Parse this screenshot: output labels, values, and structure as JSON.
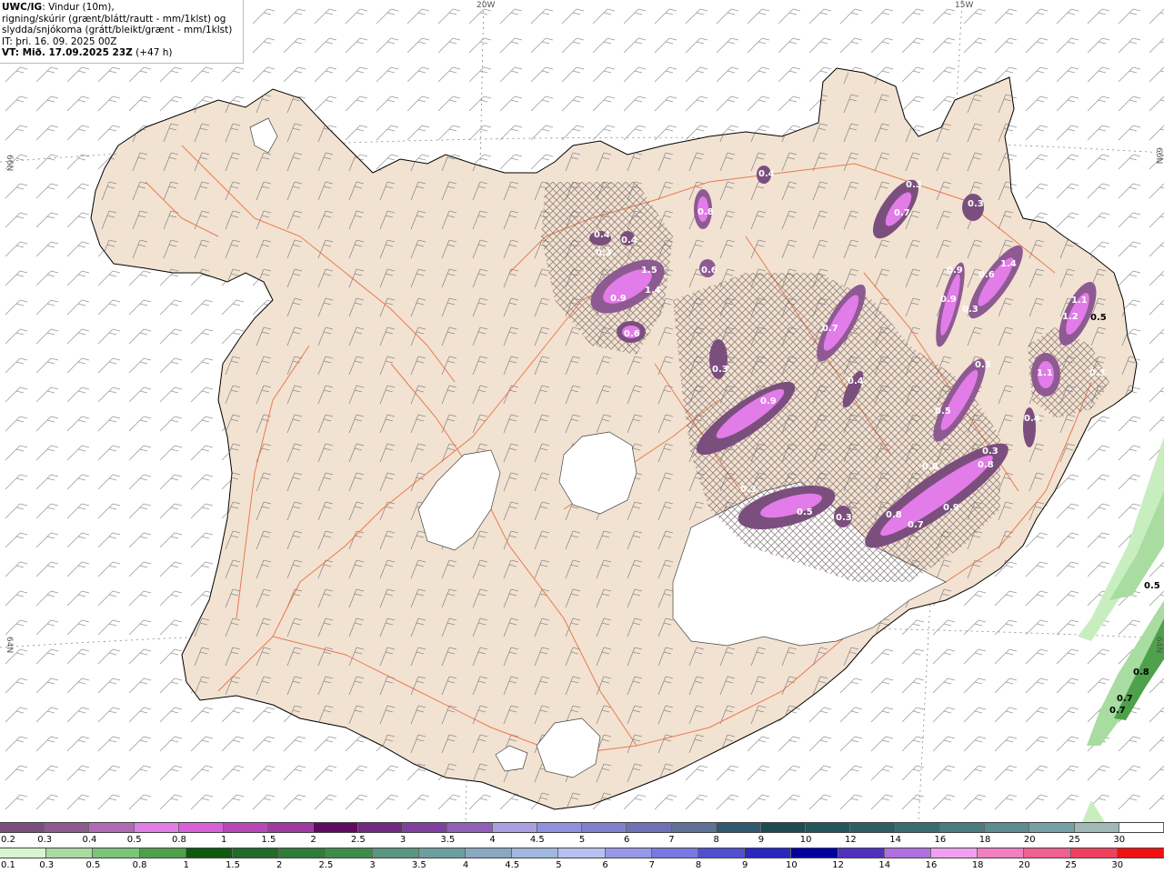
{
  "header": {
    "line1_bold": "UWC/IG",
    "line1_rest": ": Vindur (10m),",
    "line2": "rigning/skúrir (grænt/blátt/rautt - mm/1klst) og",
    "line3": "slydda/snjókoma (grátt/bleikt/grænt - mm/1klst)",
    "line4": "IT: þri. 16. 09. 2025 00Z",
    "line5_bold": "VT: Mið. 17.09.2025 23Z",
    "line5_rest": " (+47 h)"
  },
  "map": {
    "lon_labels": [
      "20W",
      "15W"
    ],
    "lat_labels": [
      "66N",
      "66N",
      "64N",
      "64N"
    ],
    "land_color": "#f2e2d2",
    "road_color": "#e8683a",
    "glacier_color": "#ffffff",
    "precip_values": [
      {
        "label": "0.4"
      },
      {
        "label": "0.4"
      },
      {
        "label": "0.3"
      },
      {
        "label": "1.5"
      },
      {
        "label": "0.9"
      },
      {
        "label": "1.4"
      },
      {
        "label": "0.6"
      },
      {
        "label": "0.8"
      },
      {
        "label": "0.6"
      },
      {
        "label": "0.4"
      },
      {
        "label": "0.7"
      },
      {
        "label": "0.3"
      },
      {
        "label": "0.3"
      },
      {
        "label": "0.9"
      },
      {
        "label": "0.7"
      },
      {
        "label": "0.3"
      },
      {
        "label": "0.4"
      },
      {
        "label": "0.9"
      },
      {
        "label": "0.3"
      },
      {
        "label": "0.3"
      },
      {
        "label": "0.5"
      },
      {
        "label": "0.3"
      },
      {
        "label": "0.8"
      },
      {
        "label": "0.8"
      },
      {
        "label": "0.7"
      },
      {
        "label": "0.9"
      },
      {
        "label": "1.4"
      },
      {
        "label": "0.6"
      },
      {
        "label": "0.9"
      },
      {
        "label": "0.5"
      },
      {
        "label": "0.5"
      },
      {
        "label": "0.3"
      },
      {
        "label": "0.8"
      },
      {
        "label": "1.1"
      },
      {
        "label": "1.2"
      },
      {
        "label": "1.1"
      },
      {
        "label": "0.4"
      },
      {
        "label": "0.3"
      }
    ],
    "rain_values": [
      {
        "label": "0.5"
      },
      {
        "label": "0.5"
      },
      {
        "label": "0.8"
      },
      {
        "label": "0.7"
      },
      {
        "label": "0.7"
      }
    ]
  },
  "snow_scale": {
    "labels": [
      "0.2",
      "0.3",
      "0.4",
      "0.5",
      "0.8",
      "1",
      "1.5",
      "2",
      "2.5",
      "3",
      "3.5",
      "4",
      "4.5",
      "5",
      "6",
      "7",
      "8",
      "9",
      "10",
      "12",
      "14",
      "16",
      "18",
      "20",
      "25",
      "30"
    ],
    "colors": [
      "#7b4f7d",
      "#8e5a92",
      "#b06ab5",
      "#e27ce8",
      "#d860d8",
      "#b848b8",
      "#a03aa0",
      "#600a60",
      "#702880",
      "#8040a0",
      "#9060b8",
      "#a8a0e0",
      "#9090e0",
      "#8080d0",
      "#7070b8",
      "#5e7096",
      "#2e5870",
      "#1e4a50",
      "#24545c",
      "#2e5e64",
      "#3a6c70",
      "#4a7c80",
      "#5c8c90",
      "#76a0a4",
      "#a0b8b8",
      "#ffffff"
    ]
  },
  "rain_scale": {
    "labels": [
      "0.1",
      "0.3",
      "0.5",
      "0.8",
      "1",
      "1.5",
      "2",
      "2.5",
      "3",
      "3.5",
      "4",
      "4.5",
      "5",
      "6",
      "7",
      "8",
      "9",
      "10",
      "12",
      "14",
      "16",
      "18",
      "20",
      "25",
      "30"
    ],
    "colors": [
      "#d6f5d0",
      "#a8dca0",
      "#7cc47a",
      "#4ea04a",
      "#0e5a0e",
      "#206c28",
      "#2e7c38",
      "#3e8c4c",
      "#5a9680",
      "#6e9ea0",
      "#8aa8c0",
      "#a0b8e0",
      "#b8c0f0",
      "#9898e8",
      "#7878e0",
      "#5050d0",
      "#2828c0",
      "#0000a0",
      "#5030c0",
      "#b070e0",
      "#f0a0f0",
      "#f080c0",
      "#f06090",
      "#f04060",
      "#f01010"
    ]
  }
}
